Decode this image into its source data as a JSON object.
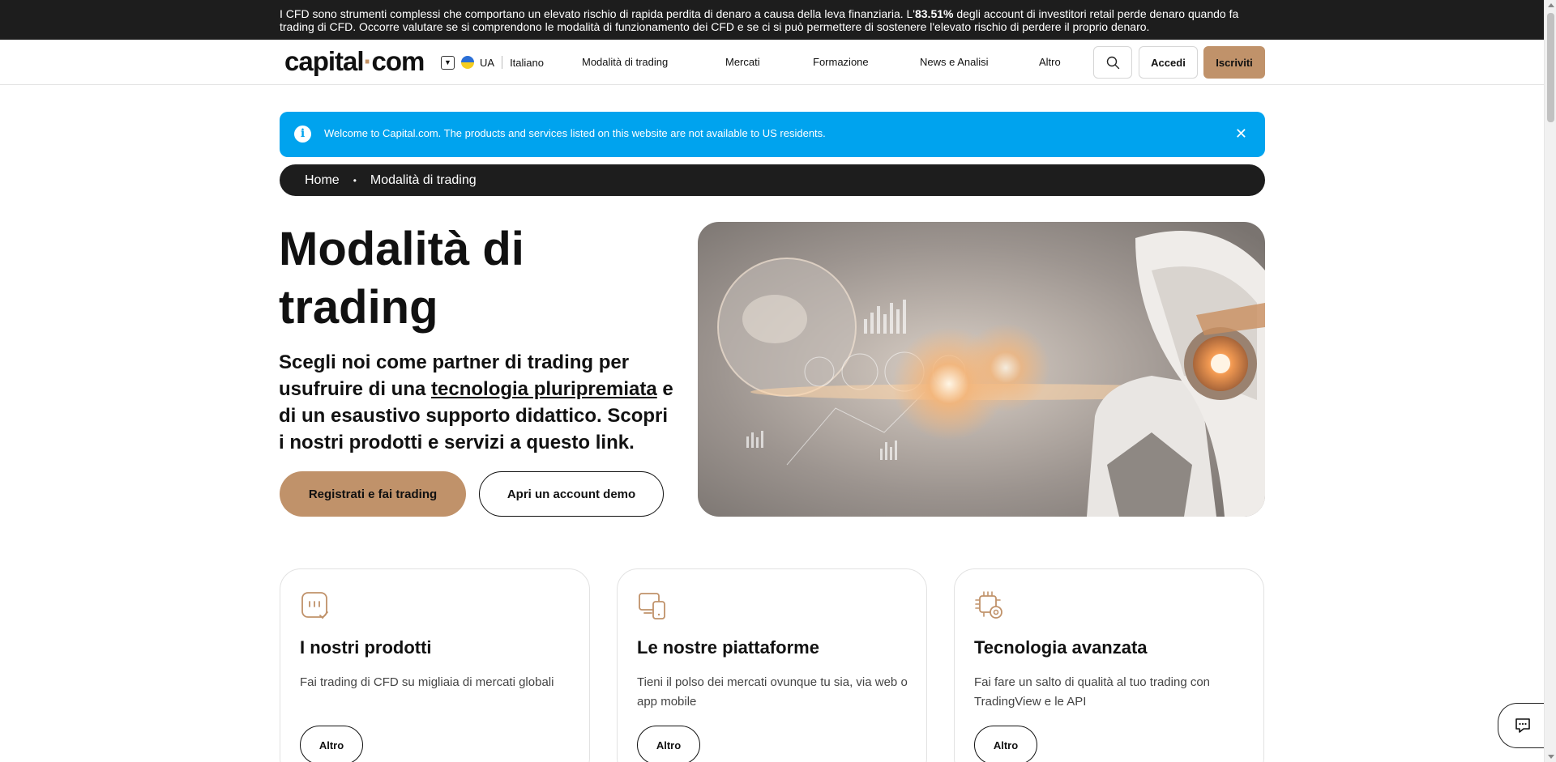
{
  "risk_warning": {
    "before": "I CFD sono strumenti complessi che comportano un elevato rischio di rapida perdita di denaro a causa della leva finanziaria. L'",
    "percentage": "83.51%",
    "after": " degli account di investitori retail perde denaro quando fa trading di CFD. Occorre valutare se si comprendono le modalità di funzionamento dei CFD e se ci si può permettere di sostenere l'elevato rischio di perdere il proprio denaro."
  },
  "header": {
    "logo_left": "capital",
    "logo_dot": "·",
    "logo_right": "com",
    "region": "UA",
    "language": "Italiano",
    "nav": [
      "Modalità di trading",
      "Mercati",
      "Formazione",
      "News e Analisi",
      "Altro"
    ],
    "login_label": "Accedi",
    "signup_label": "Iscriviti"
  },
  "alert": {
    "message": "Welcome to Capital.com. The products and services listed on this website are not available to US residents.",
    "close_glyph": "✕",
    "info_glyph": "i"
  },
  "breadcrumb": {
    "home": "Home",
    "separator": "•",
    "current": "Modalità di trading"
  },
  "hero": {
    "title": "Modalità di trading",
    "lead_before": "Scegli noi come partner di trading per usufruire di una ",
    "lead_link": "tecnologia pluripremiata",
    "lead_after": " e di un esaustivo supporto didattico. Scopri i nostri prodotti e servizi a questo link.",
    "cta_primary": "Registrati e fai trading",
    "cta_secondary": "Apri un account demo"
  },
  "cards": [
    {
      "title": "I nostri prodotti",
      "text": "Fai trading di CFD su migliaia di mercati globali",
      "button": "Altro",
      "icon": "products-icon"
    },
    {
      "title": "Le nostre piattaforme",
      "text": "Tieni il polso dei mercati ovunque tu sia, via web o app mobile",
      "button": "Altro",
      "icon": "devices-icon"
    },
    {
      "title": "Tecnologia avanzata",
      "text": "Fai fare un salto di qualità al tuo trading con TradingView e le API",
      "button": "Altro",
      "icon": "chip-gear-icon"
    }
  ],
  "colors": {
    "accent": "#c0926a",
    "alert_blue": "#00a3ee",
    "dark": "#1d1d1d"
  }
}
